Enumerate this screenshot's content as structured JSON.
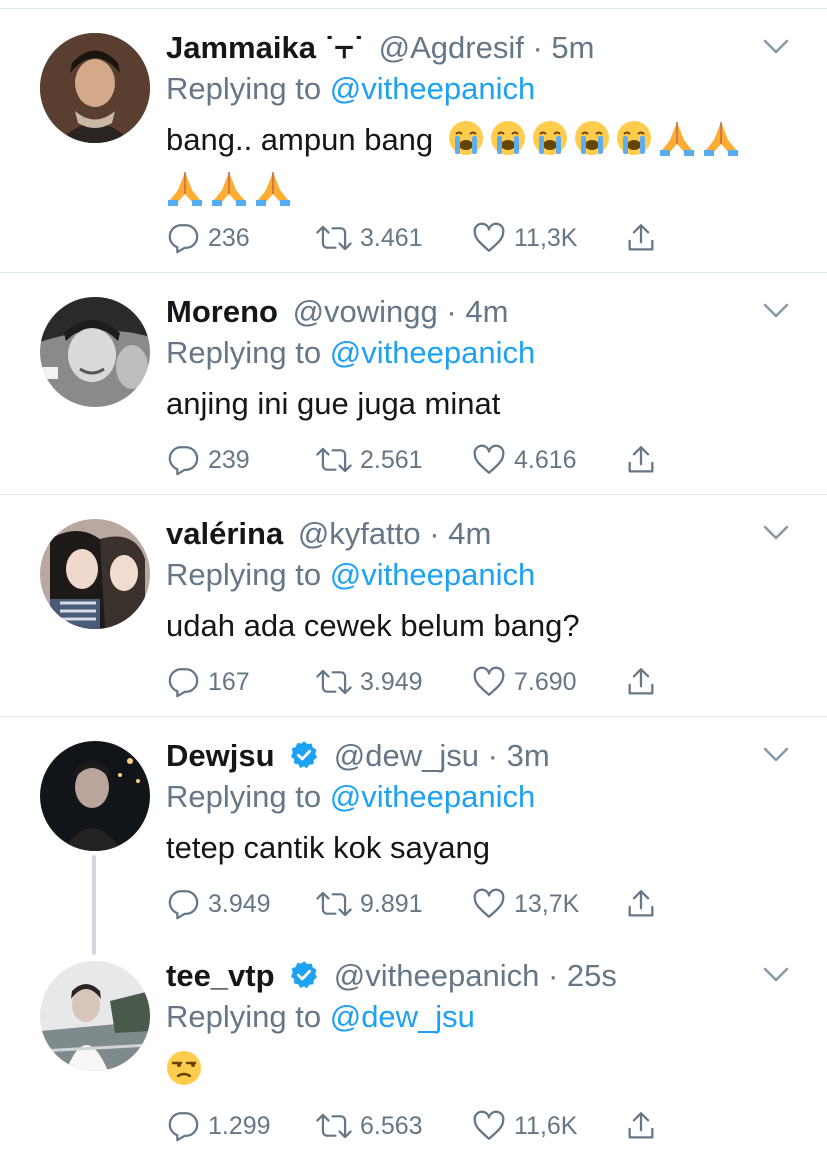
{
  "tweets": [
    {
      "name": "Jammaika ˙⫟˙",
      "handle": "@Agdresif",
      "dot": "·",
      "time": "5m",
      "replying_prefix": "Replying to",
      "replying_to": "@vitheepanich",
      "text": "bang.. ampun bang",
      "emojis": [
        "loudly-crying-face",
        "loudly-crying-face",
        "loudly-crying-face",
        "loudly-crying-face",
        "loudly-crying-face",
        "folded-hands",
        "folded-hands",
        "folded-hands",
        "folded-hands",
        "folded-hands"
      ],
      "replies": "236",
      "retweets": "3.461",
      "likes": "11,3K",
      "verified": false
    },
    {
      "name": "Moreno",
      "handle": "@vowingg",
      "dot": "·",
      "time": "4m",
      "replying_prefix": "Replying to",
      "replying_to": "@vitheepanich",
      "text": "anjing ini gue juga minat",
      "emojis": [],
      "replies": "239",
      "retweets": "2.561",
      "likes": "4.616",
      "verified": false
    },
    {
      "name": "valérina",
      "handle": "@kyfatto",
      "dot": "·",
      "time": "4m",
      "replying_prefix": "Replying to",
      "replying_to": "@vitheepanich",
      "text": "udah ada cewek belum bang?",
      "emojis": [],
      "replies": "167",
      "retweets": "3.949",
      "likes": "7.690",
      "verified": false
    },
    {
      "name": "Dewjsu",
      "handle": "@dew_jsu",
      "dot": "·",
      "time": "3m",
      "replying_prefix": "Replying to",
      "replying_to": "@vitheepanich",
      "text": "tetep cantik kok sayang",
      "emojis": [],
      "replies": "3.949",
      "retweets": "9.891",
      "likes": "13,7K",
      "verified": true
    },
    {
      "name": "tee_vtp",
      "handle": "@vitheepanich",
      "dot": "·",
      "time": "25s",
      "replying_prefix": "Replying to",
      "replying_to": "@dew_jsu",
      "text": "",
      "emojis": [
        "unamused-face"
      ],
      "replies": "1.299",
      "retweets": "6.563",
      "likes": "11,6K",
      "verified": true
    }
  ],
  "colors": {
    "link": "#1da1f2",
    "muted": "#657786",
    "text": "#14171a",
    "divider": "#e1e8ed",
    "verified": "#1da1f2"
  },
  "icons": {
    "reply": "reply-icon",
    "retweet": "retweet-icon",
    "like": "heart-icon",
    "share": "share-icon",
    "more": "chevron-down-icon",
    "verified": "verified-badge-icon"
  }
}
